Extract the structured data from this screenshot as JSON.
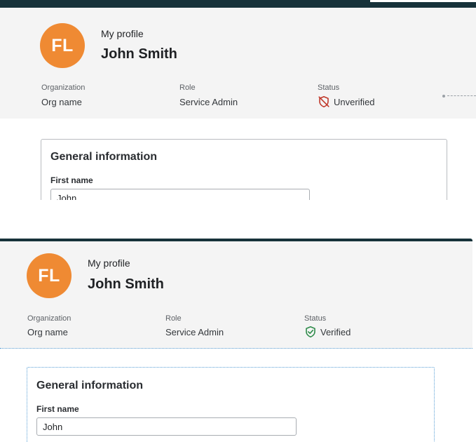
{
  "colors": {
    "avatar_bg": "#ef8a33",
    "topbar": "#17323a",
    "header_bg": "#f4f4f4",
    "unverified_icon": "#c0392b",
    "verified_icon": "#2e8b4a",
    "focus_outline": "#5aa0d6"
  },
  "profile": {
    "initials": "FL",
    "eyebrow": "My profile",
    "name": "John Smith"
  },
  "meta": {
    "organization_label": "Organization",
    "organization_value": "Org name",
    "role_label": "Role",
    "role_value": "Service Admin",
    "status_label": "Status"
  },
  "status_top": {
    "text": "Unverified",
    "icon": "shield-slash-icon"
  },
  "status_bottom": {
    "text": "Verified",
    "icon": "shield-check-icon"
  },
  "general": {
    "title": "General information",
    "first_name_label": "First name",
    "first_name_value": "John"
  }
}
